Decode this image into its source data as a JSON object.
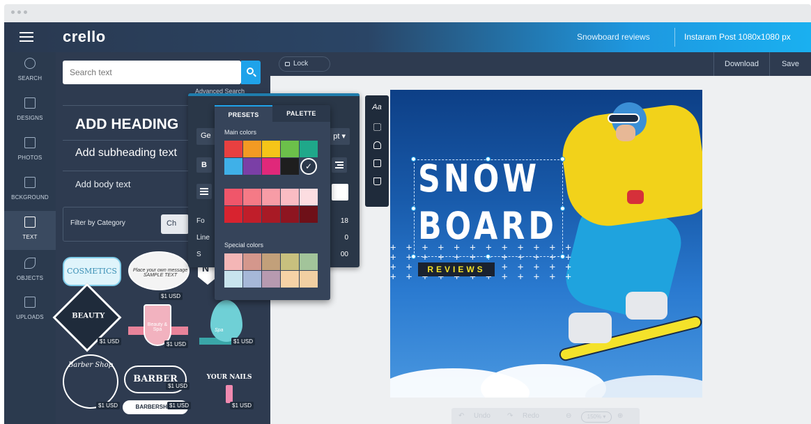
{
  "app": {
    "logo": "crello"
  },
  "header": {
    "doc_title": "Snowboard reviews",
    "doc_format": "Instaram Post 1080x1080 px"
  },
  "nav": {
    "items": [
      {
        "label": "SEARCH",
        "icon": "search-icon"
      },
      {
        "label": "DESIGNS",
        "icon": "designs-icon"
      },
      {
        "label": "PHOTOS",
        "icon": "photos-icon"
      },
      {
        "label": "BCKGROUND",
        "icon": "background-icon"
      },
      {
        "label": "TEXT",
        "icon": "text-icon"
      },
      {
        "label": "OBJECTS",
        "icon": "objects-icon"
      },
      {
        "label": "UPLOADS",
        "icon": "uploads-icon"
      }
    ],
    "active": "TEXT"
  },
  "panel": {
    "search_placeholder": "Search text",
    "advanced_search": "Advanced Search",
    "add_heading": "ADD HEADING",
    "add_subheading": "Add subheading text",
    "add_body": "Add body text",
    "filter_label": "Filter by Category",
    "filter_value": "Ch",
    "templates": [
      {
        "name": "COSMETICS",
        "price": ""
      },
      {
        "name": "Place your own message SAMPLE TEXT",
        "price": "$1 USD"
      },
      {
        "name": "N",
        "price": ""
      },
      {
        "name": "BEAUTY",
        "price": "$1 USD"
      },
      {
        "name": "Beauty & Spa",
        "price": "$1 USD"
      },
      {
        "name": "Spa",
        "price": "$1 USD"
      },
      {
        "name": "Barber Shop",
        "price": "$1 USD"
      },
      {
        "name": "BARBER",
        "price": "$1 USD"
      },
      {
        "name": "BARBERSHOP",
        "price": "$1 USD"
      },
      {
        "name": "YOUR NAILS",
        "price": "$1 USD"
      }
    ]
  },
  "toolbar": {
    "lock": "Lock",
    "download": "Download",
    "save": "Save"
  },
  "font_dialog": {
    "font_family": "Ge",
    "font_size": "pt ▾",
    "bold": "B",
    "rows": [
      {
        "label": "Fo",
        "value": "18"
      },
      {
        "label": "Line",
        "value": "0"
      },
      {
        "label": "S",
        "value": "00"
      }
    ]
  },
  "color_picker": {
    "tabs": [
      "PRESETS",
      "PALETTE"
    ],
    "active_tab": "PRESETS",
    "main_label": "Main colors",
    "special_label": "Special colors",
    "main_colors": [
      "#e84040",
      "#f39a23",
      "#f5c518",
      "#6cc04a",
      "#1fa88a",
      "#3fb0e8",
      "#7a3fa6",
      "#e0287a",
      "#1e1e1e",
      "#ffffff"
    ],
    "selected_color": "#ffffff",
    "shades": [
      "#f0566a",
      "#f57a86",
      "#f79ca6",
      "#fabcc3",
      "#fcdde1",
      "#d8232f",
      "#c01e2a",
      "#a81a25",
      "#8e1520",
      "#6e1018"
    ],
    "special_colors": [
      "#f4b6b6",
      "#d4978c",
      "#c2a07a",
      "#c8c07e",
      "#a2c49a",
      "#c8e4ee",
      "#a6b8d8",
      "#b79ab0",
      "#f6d2a6",
      "#f1cfa2"
    ]
  },
  "canvas": {
    "headline_1": "SNOW",
    "headline_2": "BOARD",
    "tagline": "REVIEWS"
  },
  "bottom": {
    "undo": "Undo",
    "redo": "Redo",
    "zoom": "150% ▾"
  }
}
